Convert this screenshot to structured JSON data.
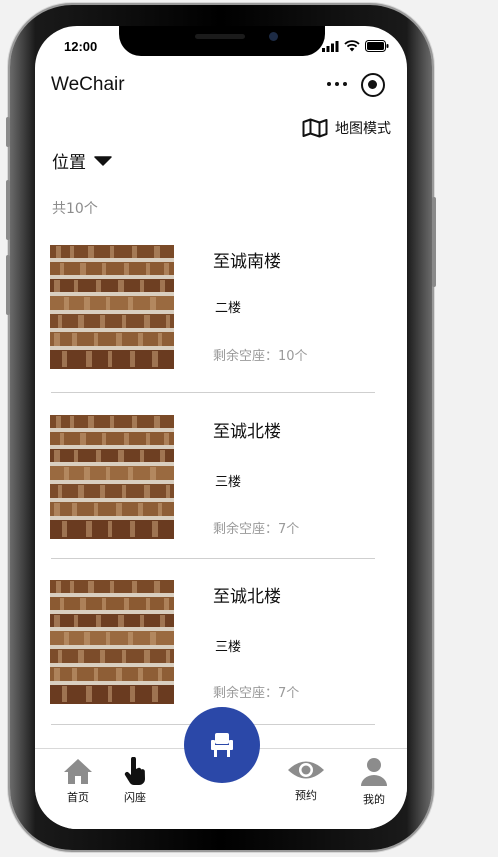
{
  "status_bar": {
    "time": "12:00"
  },
  "navbar": {
    "title": "WeChair",
    "icons": [
      "more-dots-icon",
      "target-icon"
    ]
  },
  "toolbar": {
    "map_mode_label": "地图模式",
    "location_label": "位置"
  },
  "list": {
    "count_label": "共10个",
    "items": [
      {
        "name": "至诚南楼",
        "floor": "二楼",
        "seats": "剩余空座：10个"
      },
      {
        "name": "至诚北楼",
        "floor": "三楼",
        "seats": "剩余空座：7个"
      },
      {
        "name": "至诚北楼",
        "floor": "三楼",
        "seats": "剩余空座：7个"
      }
    ]
  },
  "tabbar": {
    "home": "首页",
    "flash_seat": "闪座",
    "reserve": "预约",
    "mine": "我的"
  },
  "colors": {
    "accent": "#2b48a8",
    "muted_text": "#9a9a9a"
  }
}
